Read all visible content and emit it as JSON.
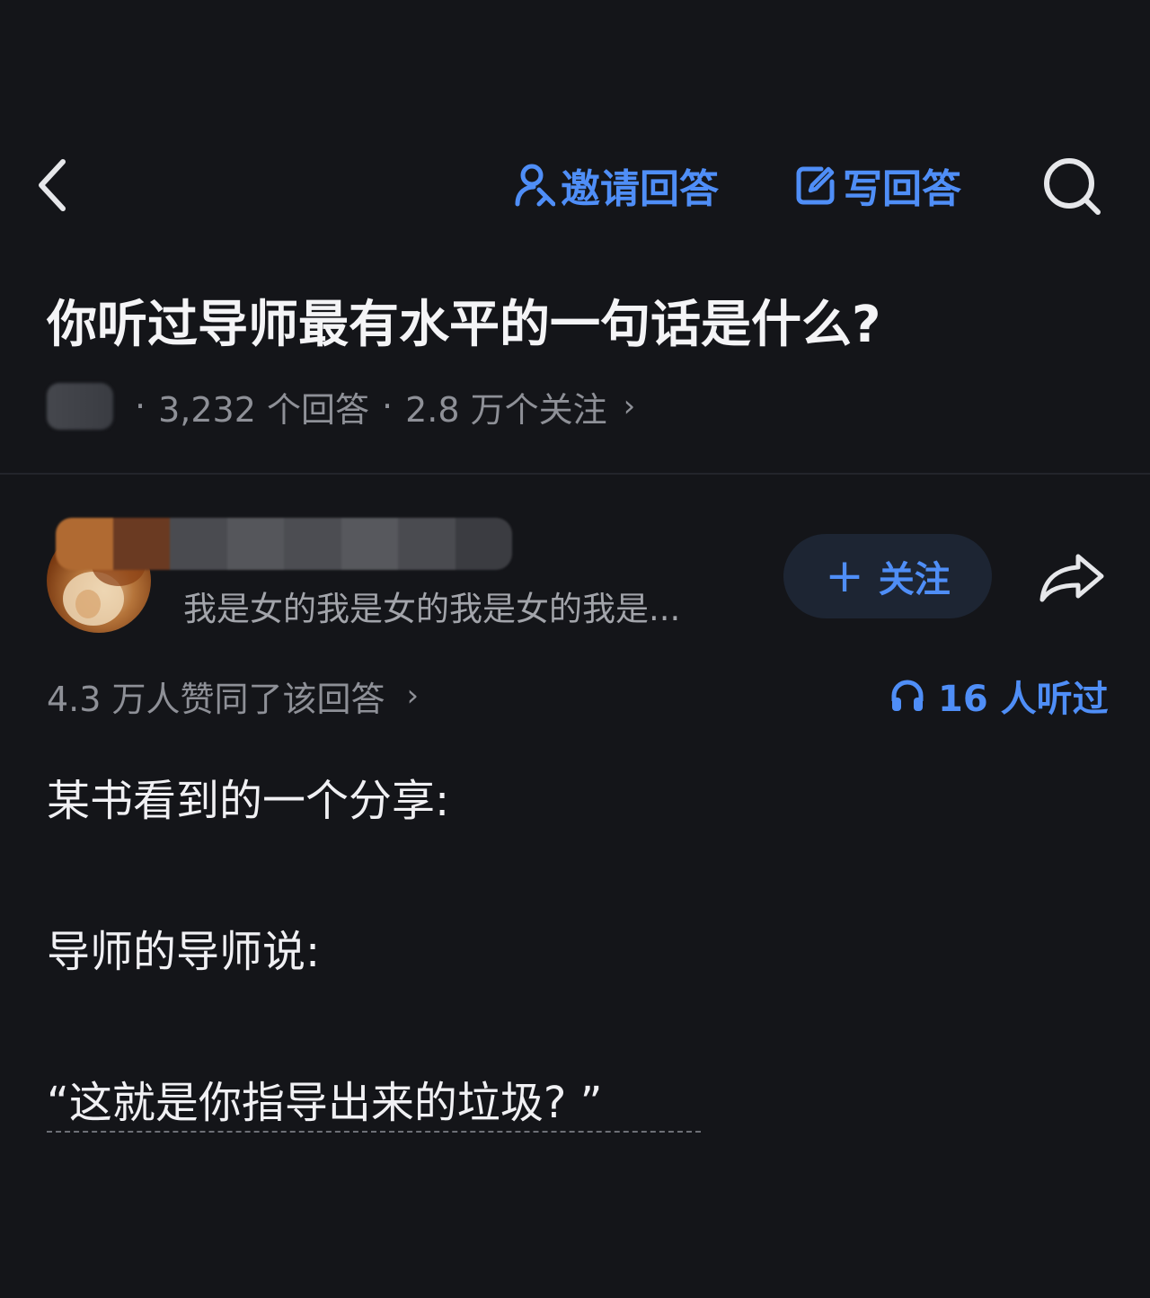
{
  "topbar": {
    "invite_label": "邀请回答",
    "write_label": "写回答"
  },
  "question": {
    "title": "你听过导师最有水平的一句话是什么?",
    "answers_count": "3,232 个回答",
    "followers_count": "2.8 万个关注",
    "separator": "·"
  },
  "answer": {
    "author_bio": "我是女的我是女的我是女的我是...",
    "follow_label": "关注",
    "agree_text": "4.3 万人赞同了该回答",
    "listen_text": "16 人听过",
    "body_lines": [
      "某书看到的一个分享:",
      "导师的导师说:",
      "“这就是你指导出来的垃圾? ”"
    ]
  },
  "colors": {
    "background": "#141519",
    "accent": "#4f8ef7",
    "secondary_text": "#8e9097",
    "follow_button_bg": "#1d2533"
  },
  "icons": [
    "back-chevron-icon",
    "person-invite-icon",
    "edit-icon",
    "search-icon",
    "plus-icon",
    "share-arrow-icon",
    "headphones-icon",
    "chevron-right-icon"
  ]
}
